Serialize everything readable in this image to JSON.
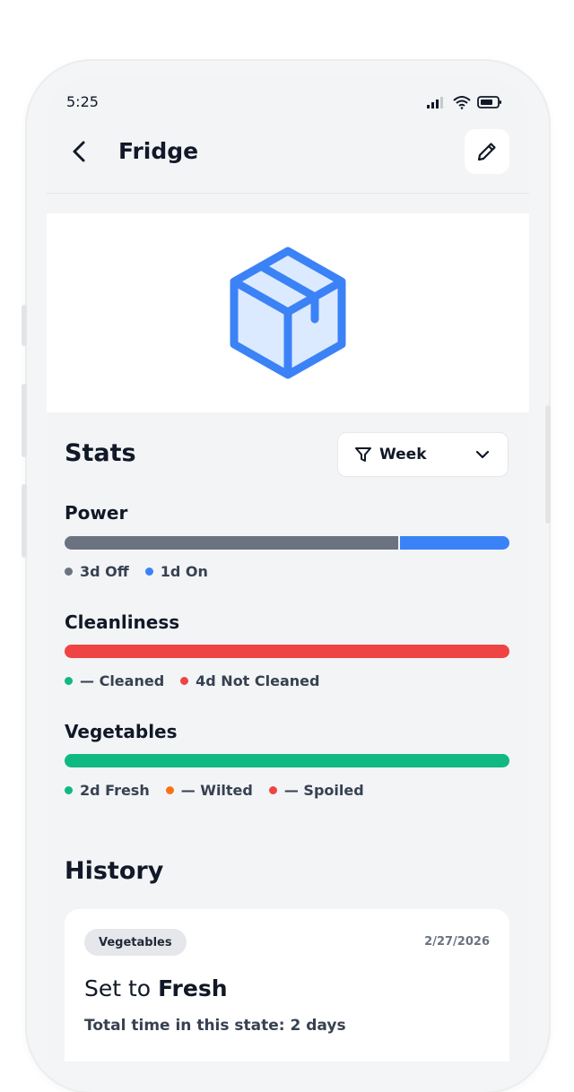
{
  "status_bar": {
    "time": "5:25"
  },
  "header": {
    "title": "Fridge"
  },
  "stats": {
    "heading": "Stats",
    "filter": {
      "label": "Week"
    },
    "power": {
      "title": "Power",
      "segments": [
        {
          "fraction": 0.75,
          "color": "#6b7280"
        },
        {
          "fraction": 0.25,
          "color": "#3b82f6"
        }
      ],
      "legend": [
        {
          "label": "3d Off",
          "color": "#6b7280"
        },
        {
          "label": "1d On",
          "color": "#3b82f6"
        }
      ]
    },
    "cleanliness": {
      "title": "Cleanliness",
      "segments": [
        {
          "fraction": 1.0,
          "color": "#ef4444"
        }
      ],
      "legend": [
        {
          "label": "— Cleaned",
          "color": "#10b981"
        },
        {
          "label": "4d Not Cleaned",
          "color": "#ef4444"
        }
      ]
    },
    "vegetables": {
      "title": "Vegetables",
      "segments": [
        {
          "fraction": 1.0,
          "color": "#10b981"
        }
      ],
      "legend": [
        {
          "label": "2d Fresh",
          "color": "#10b981"
        },
        {
          "label": "— Wilted",
          "color": "#f97316"
        },
        {
          "label": "— Spoiled",
          "color": "#ef4444"
        }
      ]
    }
  },
  "history": {
    "heading": "History",
    "entries": [
      {
        "category": "Vegetables",
        "date": "2/27/2026",
        "prefix": "Set to",
        "state": "Fresh",
        "total": "Total time in this state: 2 days"
      }
    ]
  },
  "icons": {
    "back": "chevron-left-icon",
    "edit": "pencil-icon",
    "hero": "package-box-icon",
    "filter": "funnel-icon",
    "dropdown": "chevron-down-icon"
  },
  "colors": {
    "accent": "#3b82f6",
    "box_fill": "#dbeafe",
    "background": "#f3f4f6"
  }
}
